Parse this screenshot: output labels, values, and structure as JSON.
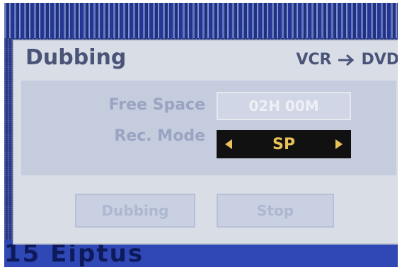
{
  "background": {
    "channel_text": "15 Eiptus"
  },
  "dialog": {
    "title": "Dubbing",
    "route": {
      "from": "VCR",
      "to": "DVD",
      "icon": "right-arrow-icon"
    },
    "free_space": {
      "label": "Free Space",
      "value": "02H 00M"
    },
    "rec_mode": {
      "label": "Rec. Mode",
      "value": "SP"
    },
    "buttons": {
      "dubbing": "Dubbing",
      "stop": "Stop"
    }
  },
  "colors": {
    "panel": "#d8dde6",
    "inner_panel": "#c4ccde",
    "accent_text": "#e9c35a",
    "rec_mode_bg": "#111111",
    "title": "#4a5478"
  }
}
